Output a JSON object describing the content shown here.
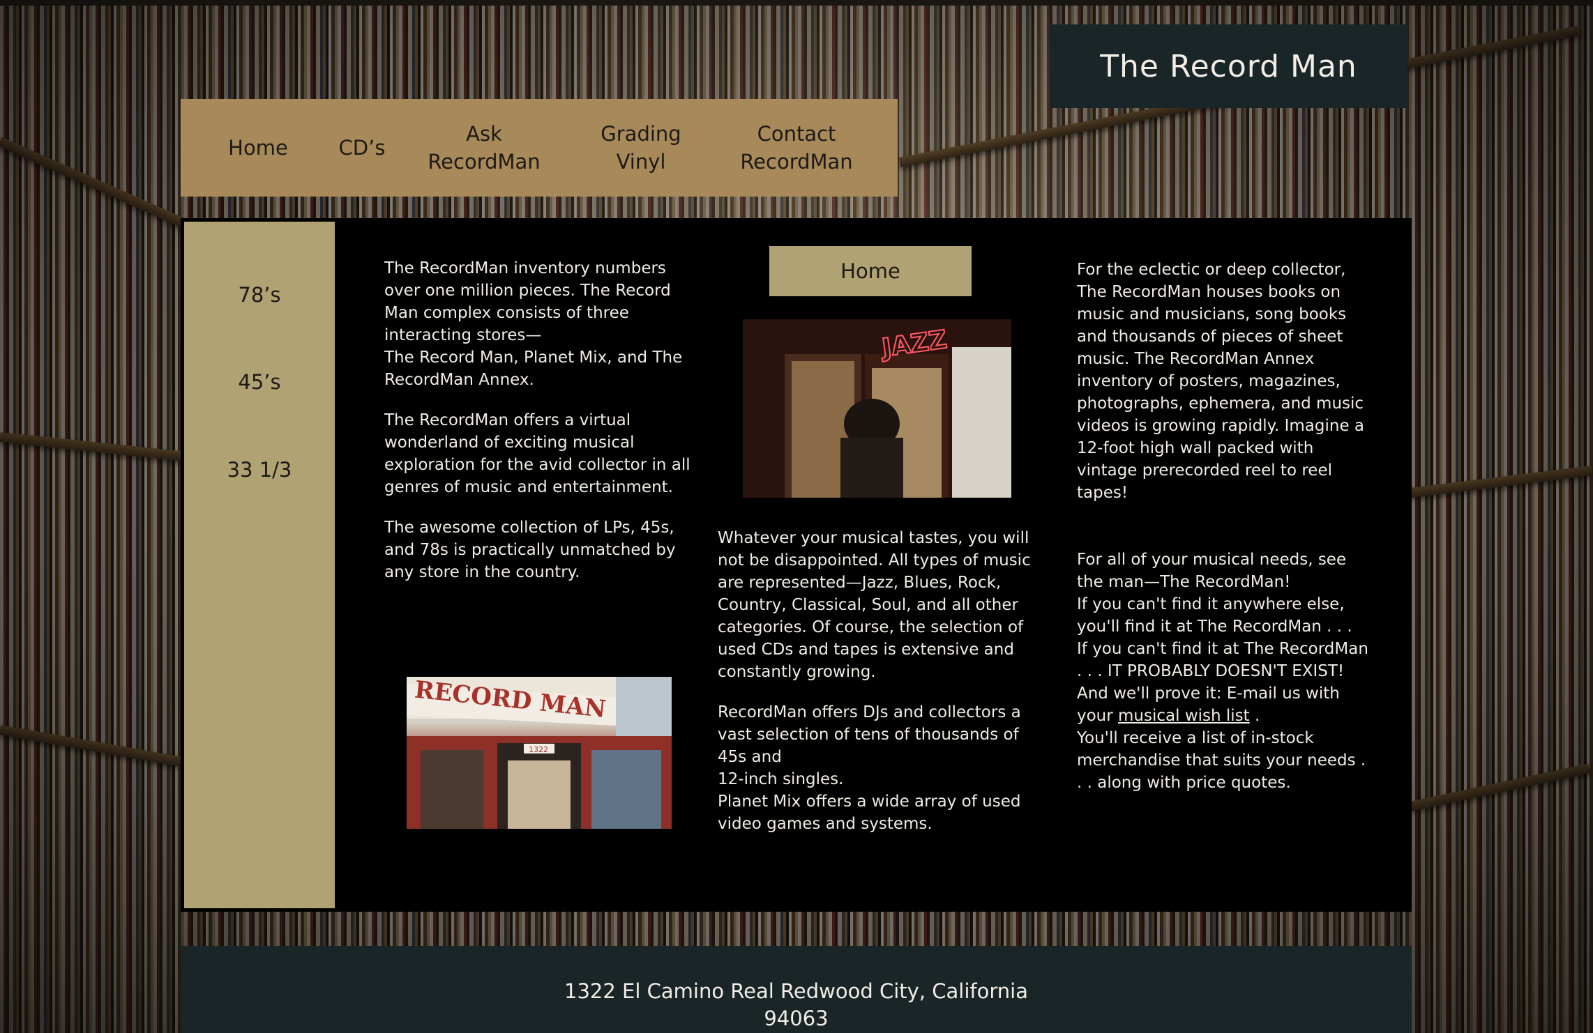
{
  "site": {
    "title": "The Record Man"
  },
  "nav": {
    "items": [
      {
        "label": "Home"
      },
      {
        "label": "CD’s"
      },
      {
        "line1": "Ask",
        "line2": "RecordMan"
      },
      {
        "line1": "Grading",
        "line2": "Vinyl"
      },
      {
        "line1": "Contact",
        "line2": "RecordMan"
      }
    ]
  },
  "sidebar": {
    "items": [
      "78’s",
      "45’s",
      "33 1/3"
    ]
  },
  "main": {
    "badge": "Home",
    "col1": {
      "p1_lines": [
        "The RecordMan inventory numbers",
        "over one million pieces.  The Record",
        "Man complex consists of three",
        "interacting stores—",
        "The Record Man, Planet Mix, and The",
        "RecordMan Annex."
      ],
      "p2_lines": [
        "The RecordMan offers a virtual",
        "wonderland of exciting musical",
        "exploration for the avid collector in all",
        "genres of music and entertainment."
      ],
      "p3_lines": [
        "The awesome collection of LPs, 45s,",
        "and 78s is practically unmatched by",
        "any store in the country."
      ]
    },
    "col2": {
      "p1_lines": [
        "Whatever your musical tastes, you will",
        "not be disappointed. All types of music",
        "are represented—Jazz, Blues, Rock,",
        "Country, Classical, Soul, and all other",
        "categories. Of course, the selection of",
        "used CDs and tapes is extensive and",
        "constantly growing."
      ],
      "p2_lines": [
        "RecordMan offers DJs and collectors a",
        "vast selection of tens of thousands of",
        "45s and",
        "12-inch singles.",
        "Planet Mix offers a wide array of used",
        "video games and systems."
      ]
    },
    "col3": {
      "p1_lines": [
        "For the eclectic or deep collector,",
        "The RecordMan houses books on",
        "music and musicians, song books",
        "and thousands of pieces of sheet",
        "music. The RecordMan Annex",
        "inventory of posters, magazines,",
        "photographs, ephemera, and music",
        "videos is growing rapidly. Imagine a",
        "12-foot high wall packed with",
        "vintage prerecorded reel to reel",
        "tapes!"
      ],
      "p2_lines": [
        "For all of your musical needs, see",
        "the man—The RecordMan!",
        "If you can't find it anywhere else,",
        "you'll find it at The RecordMan . . .",
        "If you can't find it at The RecordMan",
        ". . . IT PROBABLY DOESN'T EXIST!",
        "And we'll prove it: E-mail us with"
      ],
      "your_prefix": "your",
      "wish_link": "musical wish list",
      "wish_suffix": ".",
      "p2_tail_lines": [
        "You'll receive a list of in-stock",
        "merchandise that suits your needs .",
        ". . along with price quotes."
      ]
    },
    "images": {
      "neon_sign": "JAZZ",
      "storefront_sign": "RECORD MAN",
      "storefront_number": "1322"
    }
  },
  "footer": {
    "line1": "1322 El Camino Real Redwood City, California",
    "line2": "94063"
  },
  "colors": {
    "nav_bg": "#a8895a",
    "sidebar_bg": "#b0a273",
    "title_bg": "#1a2528",
    "main_bg": "#000000",
    "text_light": "#f0ece4"
  }
}
